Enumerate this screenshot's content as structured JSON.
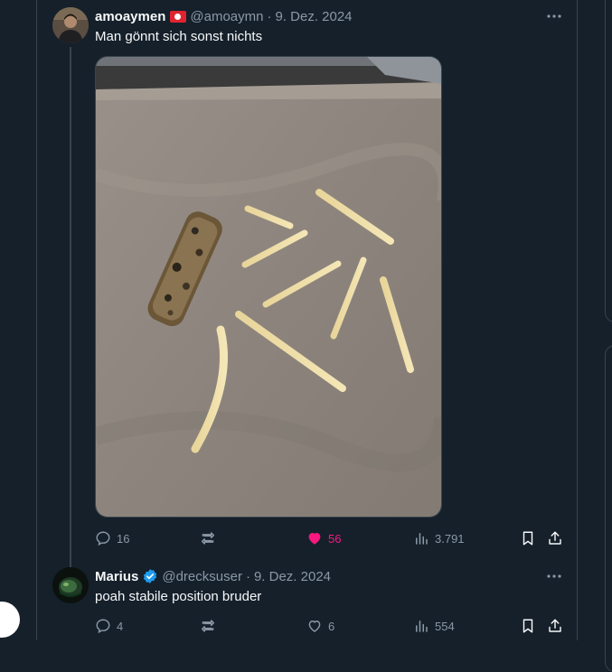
{
  "tweets": [
    {
      "display_name": "amoaymen",
      "flag": "Tunisia flag",
      "handle": "@amoaymn",
      "separator": "·",
      "date": "9. Dez. 2024",
      "text": "Man gönnt sich sonst nichts",
      "media": "photo of a breaded fish stick and french fries on baking paper",
      "stats": {
        "replies": "16",
        "retweets": "",
        "likes": "56",
        "views": "3.791"
      },
      "liked": true
    },
    {
      "display_name": "Marius",
      "verified": true,
      "handle": "@drecksuser",
      "separator": "·",
      "date": "9. Dez. 2024",
      "text": "poah stabile position bruder",
      "stats": {
        "replies": "4",
        "retweets": "",
        "likes": "6",
        "views": "554"
      },
      "liked": false
    }
  ],
  "colors": {
    "background": "#15202b",
    "text": "#f7f9f9",
    "secondary_text": "#8b98a5",
    "border": "#38444d",
    "like_active": "#f91880",
    "verified": "#1d9bf0"
  }
}
